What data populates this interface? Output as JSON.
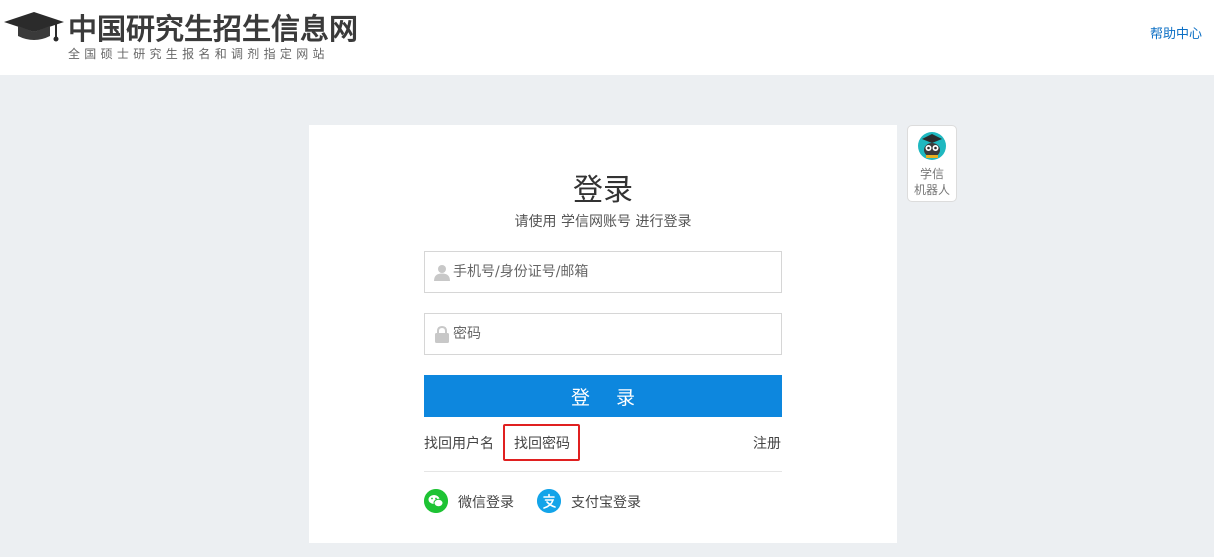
{
  "header": {
    "site_title": "中国研究生招生信息网",
    "site_subtitle": "全国硕士研究生报名和调剂指定网站",
    "help_link": "帮助中心",
    "logo_icon": "graduation-cap-icon"
  },
  "login": {
    "title": "登录",
    "subtitle": "请使用 学信网账号 进行登录",
    "username_placeholder": "手机号/身份证号/邮箱",
    "password_placeholder": "密码",
    "username_value": "",
    "password_value": "",
    "submit_label": "登 录",
    "find_username": "找回用户名",
    "find_password": "找回密码",
    "register": "注册",
    "wechat_login": "微信登录",
    "alipay_login": "支付宝登录"
  },
  "robot": {
    "line1": "学信",
    "line2": "机器人"
  },
  "colors": {
    "accent": "#0d87de",
    "link_blue": "#0a6ec4",
    "wechat_green": "#1ec334",
    "alipay_blue": "#13a4e9",
    "highlight_red": "#e02020",
    "page_background": "#eceff2"
  }
}
